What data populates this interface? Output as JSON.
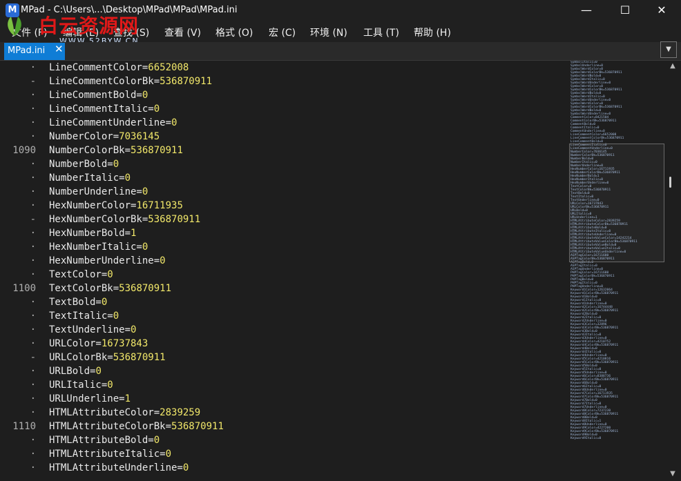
{
  "window": {
    "title": "MPad - C:\\Users\\...\\Desktop\\MPad\\MPad\\MPad.ini",
    "app_icon_letter": "M",
    "minimize": "—",
    "maximize": "☐",
    "close": "✕"
  },
  "menu": [
    {
      "label": "文件 (F)"
    },
    {
      "label": "编辑 (E)"
    },
    {
      "label": "查找 (S)"
    },
    {
      "label": "查看 (V)"
    },
    {
      "label": "格式 (O)"
    },
    {
      "label": "宏 (C)"
    },
    {
      "label": "环境 (N)"
    },
    {
      "label": "工具 (T)"
    },
    {
      "label": "帮助 (H)"
    }
  ],
  "watermark": {
    "main": "白云资源网",
    "sub": "WWW.52BYW.CN"
  },
  "tab": {
    "label": "MPad.ini",
    "close": "✕",
    "dropdown": "▼"
  },
  "gutter": [
    "·",
    "-",
    "·",
    "·",
    "·",
    "·",
    "1090",
    "·",
    "·",
    "·",
    "·",
    "-",
    "·",
    "·",
    "·",
    "·",
    "1100",
    "·",
    "·",
    "·",
    "·",
    "-",
    "·",
    "·",
    "·",
    "·",
    "1110",
    "·",
    "·",
    "·"
  ],
  "code_lines": [
    {
      "key": "LineCommentColor=",
      "value": "6652008"
    },
    {
      "key": "LineCommentColorBk=",
      "value": "536870911"
    },
    {
      "key": "LineCommentBold=",
      "value": "0"
    },
    {
      "key": "LineCommentItalic=",
      "value": "0"
    },
    {
      "key": "LineCommentUnderline=",
      "value": "0"
    },
    {
      "key": "NumberColor=",
      "value": "7036145"
    },
    {
      "key": "NumberColorBk=",
      "value": "536870911"
    },
    {
      "key": "NumberBold=",
      "value": "0"
    },
    {
      "key": "NumberItalic=",
      "value": "0"
    },
    {
      "key": "NumberUnderline=",
      "value": "0"
    },
    {
      "key": "HexNumberColor=",
      "value": "16711935"
    },
    {
      "key": "HexNumberColorBk=",
      "value": "536870911"
    },
    {
      "key": "HexNumberBold=",
      "value": "1"
    },
    {
      "key": "HexNumberItalic=",
      "value": "0"
    },
    {
      "key": "HexNumberUnderline=",
      "value": "0"
    },
    {
      "key": "TextColor=",
      "value": "0"
    },
    {
      "key": "TextColorBk=",
      "value": "536870911"
    },
    {
      "key": "TextBold=",
      "value": "0"
    },
    {
      "key": "TextItalic=",
      "value": "0"
    },
    {
      "key": "TextUnderline=",
      "value": "0"
    },
    {
      "key": "URLColor=",
      "value": "16737843"
    },
    {
      "key": "URLColorBk=",
      "value": "536870911"
    },
    {
      "key": "URLBold=",
      "value": "0"
    },
    {
      "key": "URLItalic=",
      "value": "0"
    },
    {
      "key": "URLUnderline=",
      "value": "1"
    },
    {
      "key": "HTMLAttributeColor=",
      "value": "2839259"
    },
    {
      "key": "HTMLAttributeColorBk=",
      "value": "536870911"
    },
    {
      "key": "HTMLAttributeBold=",
      "value": "0"
    },
    {
      "key": "HTMLAttributeItalic=",
      "value": "0"
    },
    {
      "key": "HTMLAttributeUnderline=",
      "value": "0"
    }
  ],
  "minimap_lines": [
    "SymbolItalic=0",
    "SymbolUnderline=0",
    "SymbolWordColor=0",
    "SymbolWordColorBk=536870911",
    "SymbolWordBold=0",
    "SymbolWordItalic=0",
    "SymbolWordUnderline=0",
    "SymbolWordColor=0",
    "SymbolWordColorBk=536870911",
    "SymbolWordBold=0",
    "SymbolWordItalic=0",
    "SymbolWordUnderline=0",
    "SymbolWordColor=0",
    "SymbolWordColorBk=536870911",
    "SymbolWordBold=0",
    "SymbolWordUnderline=0",
    "CommentColor=8421504",
    "CommentColorBk=536870911",
    "CommentBold=0",
    "CommentItalic=0",
    "CommentUnderline=0",
    "LineCommentColor=6652008",
    "LineCommentColorBk=536870911",
    "LineCommentBold=0",
    "LineCommentItalic=0",
    "LineCommentUnderline=0",
    "NumberColor=7036145",
    "NumberColorBk=536870911",
    "NumberBold=0",
    "NumberItalic=0",
    "NumberUnderline=0",
    "HexNumberColor=16711935",
    "HexNumberColorBk=536870911",
    "HexNumberBold=1",
    "HexNumberItalic=0",
    "HexNumberUnderline=0",
    "TextColor=0",
    "TextColorBk=536870911",
    "TextBold=0",
    "TextItalic=0",
    "TextUnderline=0",
    "URLColor=16737843",
    "URLColorBk=536870911",
    "URLBold=0",
    "URLItalic=0",
    "URLUnderline=1",
    "HTMLAttributeColor=2839259",
    "HTMLAttributeColorBk=536870911",
    "HTMLAttributeBold=0",
    "HTMLAttributeItalic=0",
    "HTMLAttributeUnderline=0",
    "HTMLAttributeValueColor=14242214",
    "HTMLAttributeValueColorBk=536870911",
    "HTMLAttributeValueBold=0",
    "HTMLAttributeValueItalic=0",
    "HTMLAttributeValueUnderline=0",
    "ASPTagColor=16711680",
    "ASPTagColorBk=536870911",
    "ASPTagBold=0",
    "ASPTagItalic=0",
    "ASPTagUnderline=0",
    "PHPTagColor=16711680",
    "PHPTagColorBk=536870911",
    "PHPTagBold=0",
    "PHPTagItalic=0",
    "PHPTagUnderline=0",
    "Keyword1Color=12632064",
    "Keyword1ColorBk=536870911",
    "Keyword1Bold=0",
    "Keyword1Italic=0",
    "Keyword1Underline=0",
    "Keyword2Color=16744448",
    "Keyword2ColorBk=536870911",
    "Keyword2Bold=0",
    "Keyword2Italic=0",
    "Keyword2Underline=0",
    "Keyword3Color=32896",
    "Keyword3ColorBk=536870911",
    "Keyword3Bold=0",
    "Keyword3Italic=0",
    "Keyword3Underline=0",
    "Keyword4Color=4210752",
    "Keyword4ColorBk=536870911",
    "Keyword4Bold=0",
    "Keyword4Italic=0",
    "Keyword4Underline=0",
    "Keyword5Color=4210816",
    "Keyword5ColorBk=536870911",
    "Keyword5Bold=0",
    "Keyword5Italic=0",
    "Keyword5Underline=0",
    "Keyword6Color=8388736",
    "Keyword6ColorBk=536870911",
    "Keyword6Bold=0",
    "Keyword6Italic=0",
    "Keyword6Underline=0",
    "Keyword7Color=16711935",
    "Keyword7ColorBk=536870911",
    "Keyword7Bold=0",
    "Keyword7Italic=0",
    "Keyword7Underline=0",
    "Keyword8Color=7237230",
    "Keyword8ColorBk=536870911",
    "Keyword8Bold=0",
    "Keyword8Italic=1",
    "Keyword8Underline=0",
    "Keyword9Color=4227200",
    "Keyword9ColorBk=536870911",
    "Keyword9Bold=0",
    "Keyword9Italic=0"
  ],
  "colors": {
    "key_text": "#eaeaea",
    "value_text": "#f2e86a",
    "tab_active": "#0f7dd6",
    "background": "#1e1e1e"
  }
}
